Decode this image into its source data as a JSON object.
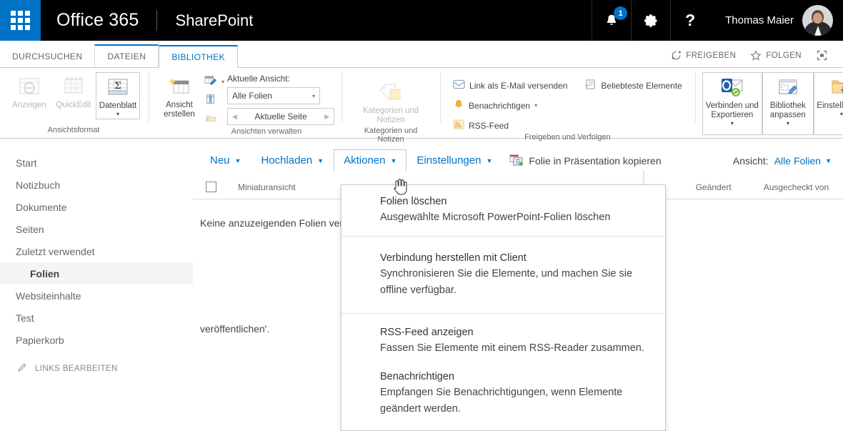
{
  "suite": {
    "waffle_icon": "app-launcher-icon",
    "office_label": "Office 365",
    "app_label": "SharePoint",
    "notification_icon": "bell-icon",
    "notification_count": "1",
    "settings_icon": "gear-icon",
    "help_icon": "question-mark-icon",
    "user_name": "Thomas Maier",
    "avatar_icon": "user-avatar",
    "accent_color": "#0072c6",
    "bar_color": "#000000"
  },
  "tabs": [
    {
      "label": "DURCHSUCHEN",
      "active": false
    },
    {
      "label": "DATEIEN",
      "active": false
    },
    {
      "label": "BIBLIOTHEK",
      "active": true
    }
  ],
  "tab_actions": [
    {
      "label": "FREIGEBEN",
      "icon": "share-icon"
    },
    {
      "label": "FOLGEN",
      "icon": "star-icon"
    },
    {
      "label": "",
      "icon": "focus-on-content-icon"
    }
  ],
  "ribbon": {
    "groups": [
      {
        "name": "Ansichtsformat",
        "label": "Ansichtsformat",
        "buttons": [
          {
            "label": "Anzeigen",
            "icon": "view-icon",
            "disabled": true,
            "boxed": false,
            "caret": false
          },
          {
            "label": "QuickEdit",
            "icon": "quick-edit-icon",
            "disabled": true,
            "boxed": false,
            "caret": false
          },
          {
            "label": "Datenblatt",
            "icon": "datasheet-icon",
            "disabled": false,
            "boxed": true,
            "caret": true
          }
        ]
      },
      {
        "name": "Ansichten verwalten",
        "label": "Ansichten verwalten",
        "buttons": [
          {
            "label": "Ansicht erstellen",
            "icon": "create-view-icon",
            "disabled": false,
            "boxed": false,
            "caret": false
          }
        ],
        "small_buttons": [
          {
            "label": "",
            "icon": "modify-view-icon",
            "disabled": false,
            "caret": true
          },
          {
            "label": "",
            "icon": "create-column-icon",
            "disabled": false,
            "caret": false
          },
          {
            "label": "",
            "icon": "navigate-up-icon",
            "disabled": true,
            "caret": false
          }
        ],
        "current_view_caption": "Aktuelle Ansicht:",
        "current_view_value": "Alle Folien",
        "page_spinner_value": "Aktuelle Seite"
      },
      {
        "name": "Kategorien und Notizen",
        "label": "Kategorien und Notizen",
        "buttons": [
          {
            "label": "Kategorien und Notizen",
            "icon": "tags-and-notes-icon",
            "disabled": true,
            "boxed": false,
            "caret": false
          }
        ]
      },
      {
        "name": "Freigeben und Verfolgen",
        "label": "Freigeben und Verfolgen",
        "small_buttons": [
          {
            "label": "Link als E-Mail versenden",
            "icon": "email-link-icon",
            "disabled": false,
            "caret": false
          },
          {
            "label": "Benachrichtigen",
            "icon": "alert-me-icon",
            "disabled": false,
            "caret": true
          },
          {
            "label": "RSS-Feed",
            "icon": "rss-icon",
            "disabled": false,
            "caret": false
          }
        ],
        "small_buttons_2": [
          {
            "label": "Beliebteste Elemente",
            "icon": "most-popular-items-icon",
            "disabled": false,
            "caret": false
          }
        ]
      },
      {
        "name": "connect-and-customize",
        "label": "",
        "buttons": [
          {
            "label": "Verbinden und Exportieren",
            "icon": "outlook-connect-icon",
            "disabled": false,
            "boxed": true,
            "caret": true
          },
          {
            "label": "Bibliothek anpassen",
            "icon": "customize-library-icon",
            "disabled": false,
            "boxed": true,
            "caret": true
          },
          {
            "label": "Einstellungen",
            "icon": "library-settings-icon",
            "disabled": false,
            "boxed": true,
            "caret": true
          }
        ]
      }
    ]
  },
  "leftnav": {
    "items": [
      {
        "label": "Start",
        "selected": false,
        "sub": false
      },
      {
        "label": "Notizbuch",
        "selected": false,
        "sub": false
      },
      {
        "label": "Dokumente",
        "selected": false,
        "sub": false
      },
      {
        "label": "Seiten",
        "selected": false,
        "sub": false
      },
      {
        "label": "Zuletzt verwendet",
        "selected": false,
        "sub": false
      },
      {
        "label": "Folien",
        "selected": true,
        "sub": true
      },
      {
        "label": "Websiteinhalte",
        "selected": false,
        "sub": false
      },
      {
        "label": "Test",
        "selected": false,
        "sub": false
      },
      {
        "label": "Papierkorb",
        "selected": false,
        "sub": false
      }
    ],
    "edit_links_label": "LINKS BEARBEITEN",
    "edit_links_icon": "pencil-icon"
  },
  "commandbar": {
    "items": [
      {
        "label": "Neu",
        "caret": true,
        "open": false
      },
      {
        "label": "Hochladen",
        "caret": true,
        "open": false
      },
      {
        "label": "Aktionen",
        "caret": true,
        "open": true
      },
      {
        "label": "Einstellungen",
        "caret": true,
        "open": false
      }
    ],
    "copy_slide_label": "Folie in Präsentation kopieren",
    "copy_slide_icon": "copy-slide-icon",
    "view_label": "Ansicht:",
    "view_value": "Alle Folien"
  },
  "list": {
    "select_all_icon": "checkbox-unchecked",
    "columns": [
      "Miniaturansicht",
      "Geändert",
      "Ausgecheckt von"
    ],
    "empty_message_line1": "Keine anzuzeigenden Folien verfügbar. Klicken Sie auf 'Hochladen' und anschließend auf 'Folien",
    "empty_message_line2": "veröffentlichen'."
  },
  "menu": {
    "items": [
      {
        "title": "Folien löschen",
        "desc": "Ausgewählte Microsoft PowerPoint-Folien löschen",
        "icon": "delete-slides-icon"
      },
      {
        "title": "Verbindung herstellen mit Client",
        "desc": "Synchronisieren Sie die Elemente, und machen Sie sie offline verfügbar.",
        "icon": "connect-to-client-icon"
      },
      {
        "title": "RSS-Feed anzeigen",
        "desc": "Fassen Sie Elemente mit einem RSS-Reader zusammen.",
        "icon": "rss-feed-icon"
      },
      {
        "title": "Benachrichtigen",
        "desc": "Empfangen Sie Benachrichtigungen, wenn Elemente geändert werden.",
        "icon": "alert-me-icon"
      }
    ]
  }
}
